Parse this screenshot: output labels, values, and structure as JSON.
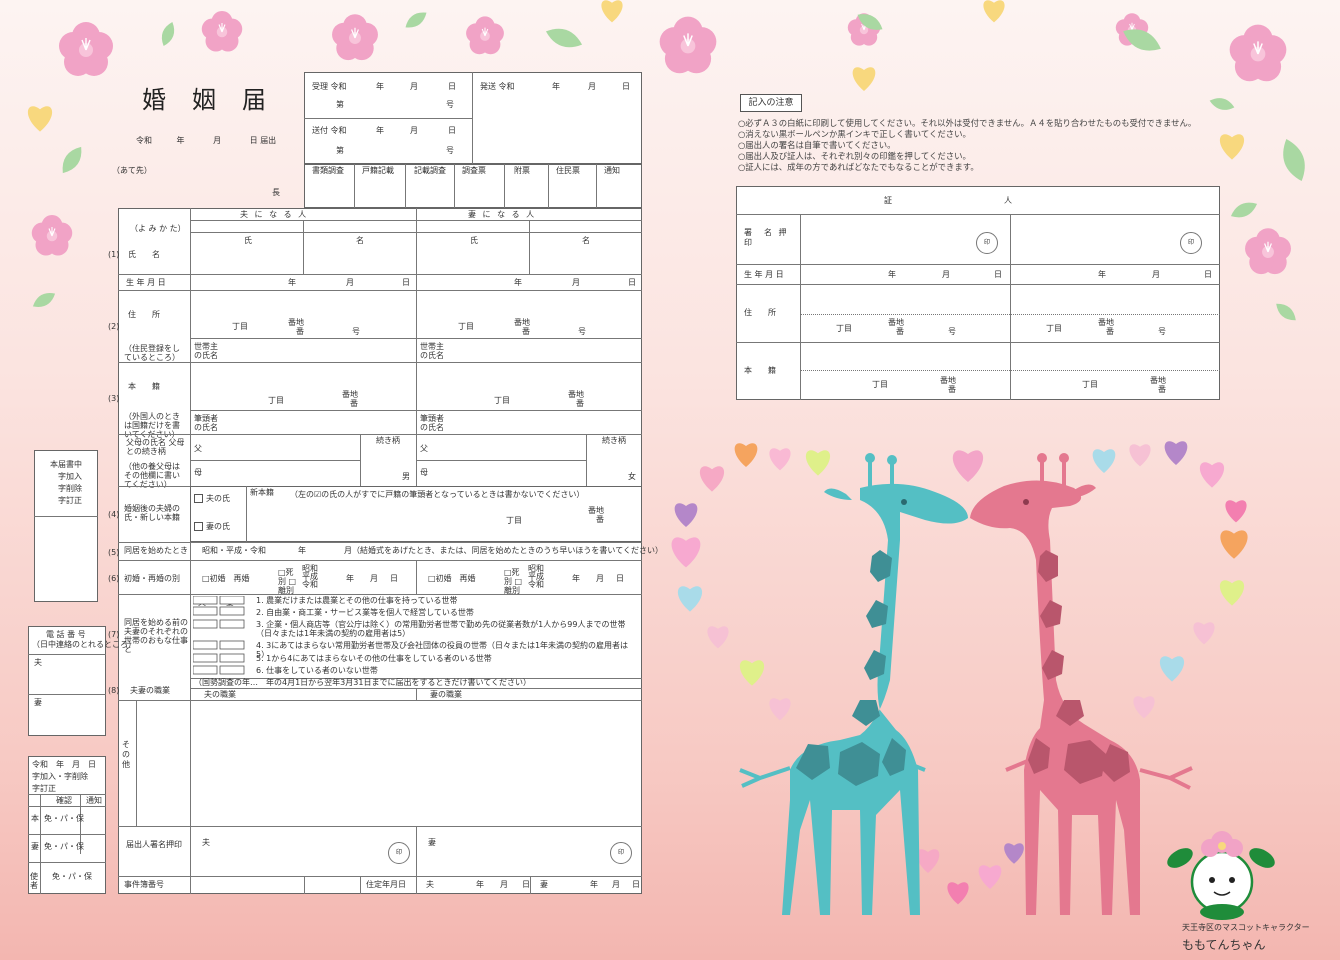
{
  "form": {
    "title": "婚姻届",
    "date_line": {
      "era": "令和",
      "year": "年",
      "month": "月",
      "day": "日",
      "suffix": "届出"
    },
    "address_to": "（あて先）",
    "chief": "長",
    "receipt": {
      "received": "受理 令和",
      "sent": "送付 令和",
      "dispatched": "発送 令和",
      "ymd": [
        "年",
        "月",
        "日"
      ],
      "no": "第",
      "go": "号"
    },
    "office_cols": [
      "書類調査",
      "戸籍記載",
      "記載調査",
      "調査票",
      "附票",
      "住民票",
      "通知"
    ],
    "groom_header": "夫 に な る 人",
    "bride_header": "妻 に な る 人",
    "yomikata": "（よ み か た）",
    "surname": "氏",
    "givenname": "名",
    "row_labels": {
      "name": "氏　　名",
      "birth": "生 年 月 日",
      "address": "住　　所",
      "address_note": "（住民登録をしているところ）",
      "householder": "世帯主の氏名",
      "honseki": "本　　籍",
      "honseki_note": "（外国人のときは国籍だけを書いてください）",
      "head": "筆頭者の氏名",
      "parents": "父母の氏名 父母との続き柄",
      "parents_note": "（他の養父母はその他欄に書いてください）",
      "new_surname": "婚姻後の夫婦の氏・新しい本籍",
      "cohabit": "同居を始めたとき",
      "remarry": "初婚・再婚の別",
      "occupation_household": "同居を始める前の夫妻のそれぞれの世帯のおもな仕事と",
      "occupation": "夫妻の職業",
      "other": "その他",
      "signer": "届出人署名押印",
      "case_no": "事件簿番号"
    },
    "ymd": [
      "年",
      "月",
      "日"
    ],
    "chome": "丁目",
    "banchi": "番地",
    "ban": "番",
    "go": "号",
    "father": "父",
    "mother": "母",
    "relation": "続き柄",
    "son": "男",
    "daughter": "女",
    "husband_surname": "夫の氏",
    "wife_surname": "妻の氏",
    "new_honseki": "新本籍",
    "new_honseki_note": "（左の☑の氏の人がすでに戸籍の筆頭者となっているときは書かないでください）",
    "cohabit_era": "昭和・平成・令和",
    "cohabit_note": "月（結婚式をあげたとき、または、同居を始めたときのうち早いほうを書いてください）",
    "first_marriage": "□初婚　再婚",
    "death_divorce": "□死別 □離別",
    "eras_small": [
      "昭和",
      "平成",
      "令和"
    ],
    "husband_short": "夫",
    "wife_short": "妻",
    "jobs": [
      "1. 農業だけまたは農業とその他の仕事を持っている世帯",
      "2. 自由業・商工業・サービス業等を個人で経営している世帯",
      "3. 企業・個人商店等（官公庁は除く）の常用勤労者世帯で勤め先の従業者数が1人から99人までの世帯（日々または1年未満の契約の雇用者は5）",
      "4. 3にあてはまらない常用勤労者世帯及び会社団体の役員の世帯（日々または1年未満の契約の雇用者は5）",
      "5. 1から4にあてはまらないその他の仕事をしている者のいる世帯",
      "6. 仕事をしている者のいない世帯"
    ],
    "census_note": "（国勢調査の年…　年の4月1日から翌年3月31日までに届出をするときだけ書いてください）",
    "husband_job": "夫の職業",
    "wife_job": "妻の職業",
    "seal": "印",
    "date_label": "住定年月日"
  },
  "side_boxes": {
    "registry": [
      "本届書中",
      "字加入",
      "字削除",
      "字訂正"
    ],
    "phone_title": "電 話 番 号",
    "phone_sub": "（日中連絡のとれるところ）",
    "husband": "夫",
    "wife": "妻",
    "small_rows": [
      "令和　年　月　日",
      "字加入・字削除",
      "字訂正"
    ],
    "small_cols": [
      "確認",
      "通知"
    ],
    "small_vals": [
      "免・パ・保",
      "免・パ・保",
      "免・パ・保"
    ],
    "side_labels": [
      "本",
      "妻",
      "使者"
    ]
  },
  "notice": {
    "title": "記入の注意",
    "lines": [
      "○必ずＡ３の白紙に印刷して使用してください。それ以外は受付できません。Ａ４を貼り合わせたものも受付できません。",
      "○消えない黒ボールペンか黒インキで正しく書いてください。",
      "○届出人の署名は自筆で書いてください。",
      "○届出人及び証人は、それぞれ別々の印鑑を押してください。",
      "○証人には、成年の方であればどなたでもなることができます。"
    ]
  },
  "witness": {
    "title": "証　　　　　　　　　　　　　　人",
    "sign": "署　名 押　印",
    "birth": "生 年 月 日",
    "address": "住　　所",
    "honseki": "本　　籍"
  },
  "mascot": {
    "caption": "天王寺区のマスコットキャラクター",
    "name": "ももてんちゃん"
  },
  "colors": {
    "background": "#f7d3cd",
    "flower": "#f1a3c6",
    "leaf": "#a9d8a2",
    "heart_yellow": "#f8d87e",
    "giraffe_blue": "#54bfc4",
    "giraffe_pink": "#e4788f"
  }
}
